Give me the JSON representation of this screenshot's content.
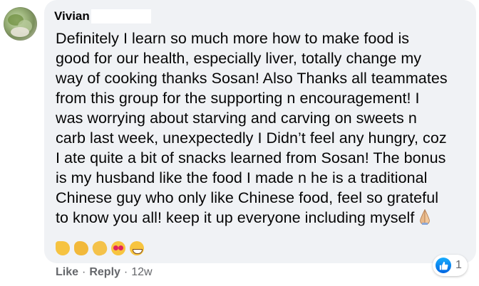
{
  "comment": {
    "author": "Vivian",
    "body_lines": [
      "Definitely I learn so much more how to make food is",
      "good for our health, especially liver, totally change my",
      "way of cooking thanks Sosan! Also Thanks all teammates",
      "from this group for the supporting n encouragement! I",
      "was worrying about starving and carving on sweets n",
      "carb last week, unexpectedly I Didn’t feel any hungry, coz",
      "I ate quite a bit of snacks learned from Sosan! The bonus",
      "is my husband like the food I made n he is a traditional",
      "Chinese guy who only like Chinese food, feel so grateful",
      "to know you all! keep it up everyone including myself"
    ],
    "emojis": [
      "thumbs-up",
      "flexed-biceps",
      "clapping-hands",
      "smiling-face-with-hearts",
      "grinning-face"
    ]
  },
  "actions": {
    "like_label": "Like",
    "separator": "·",
    "reply_label": "Reply",
    "timestamp": "12w"
  },
  "reactions": {
    "icon": "like-icon",
    "count": "1",
    "color": "#0866ff"
  }
}
